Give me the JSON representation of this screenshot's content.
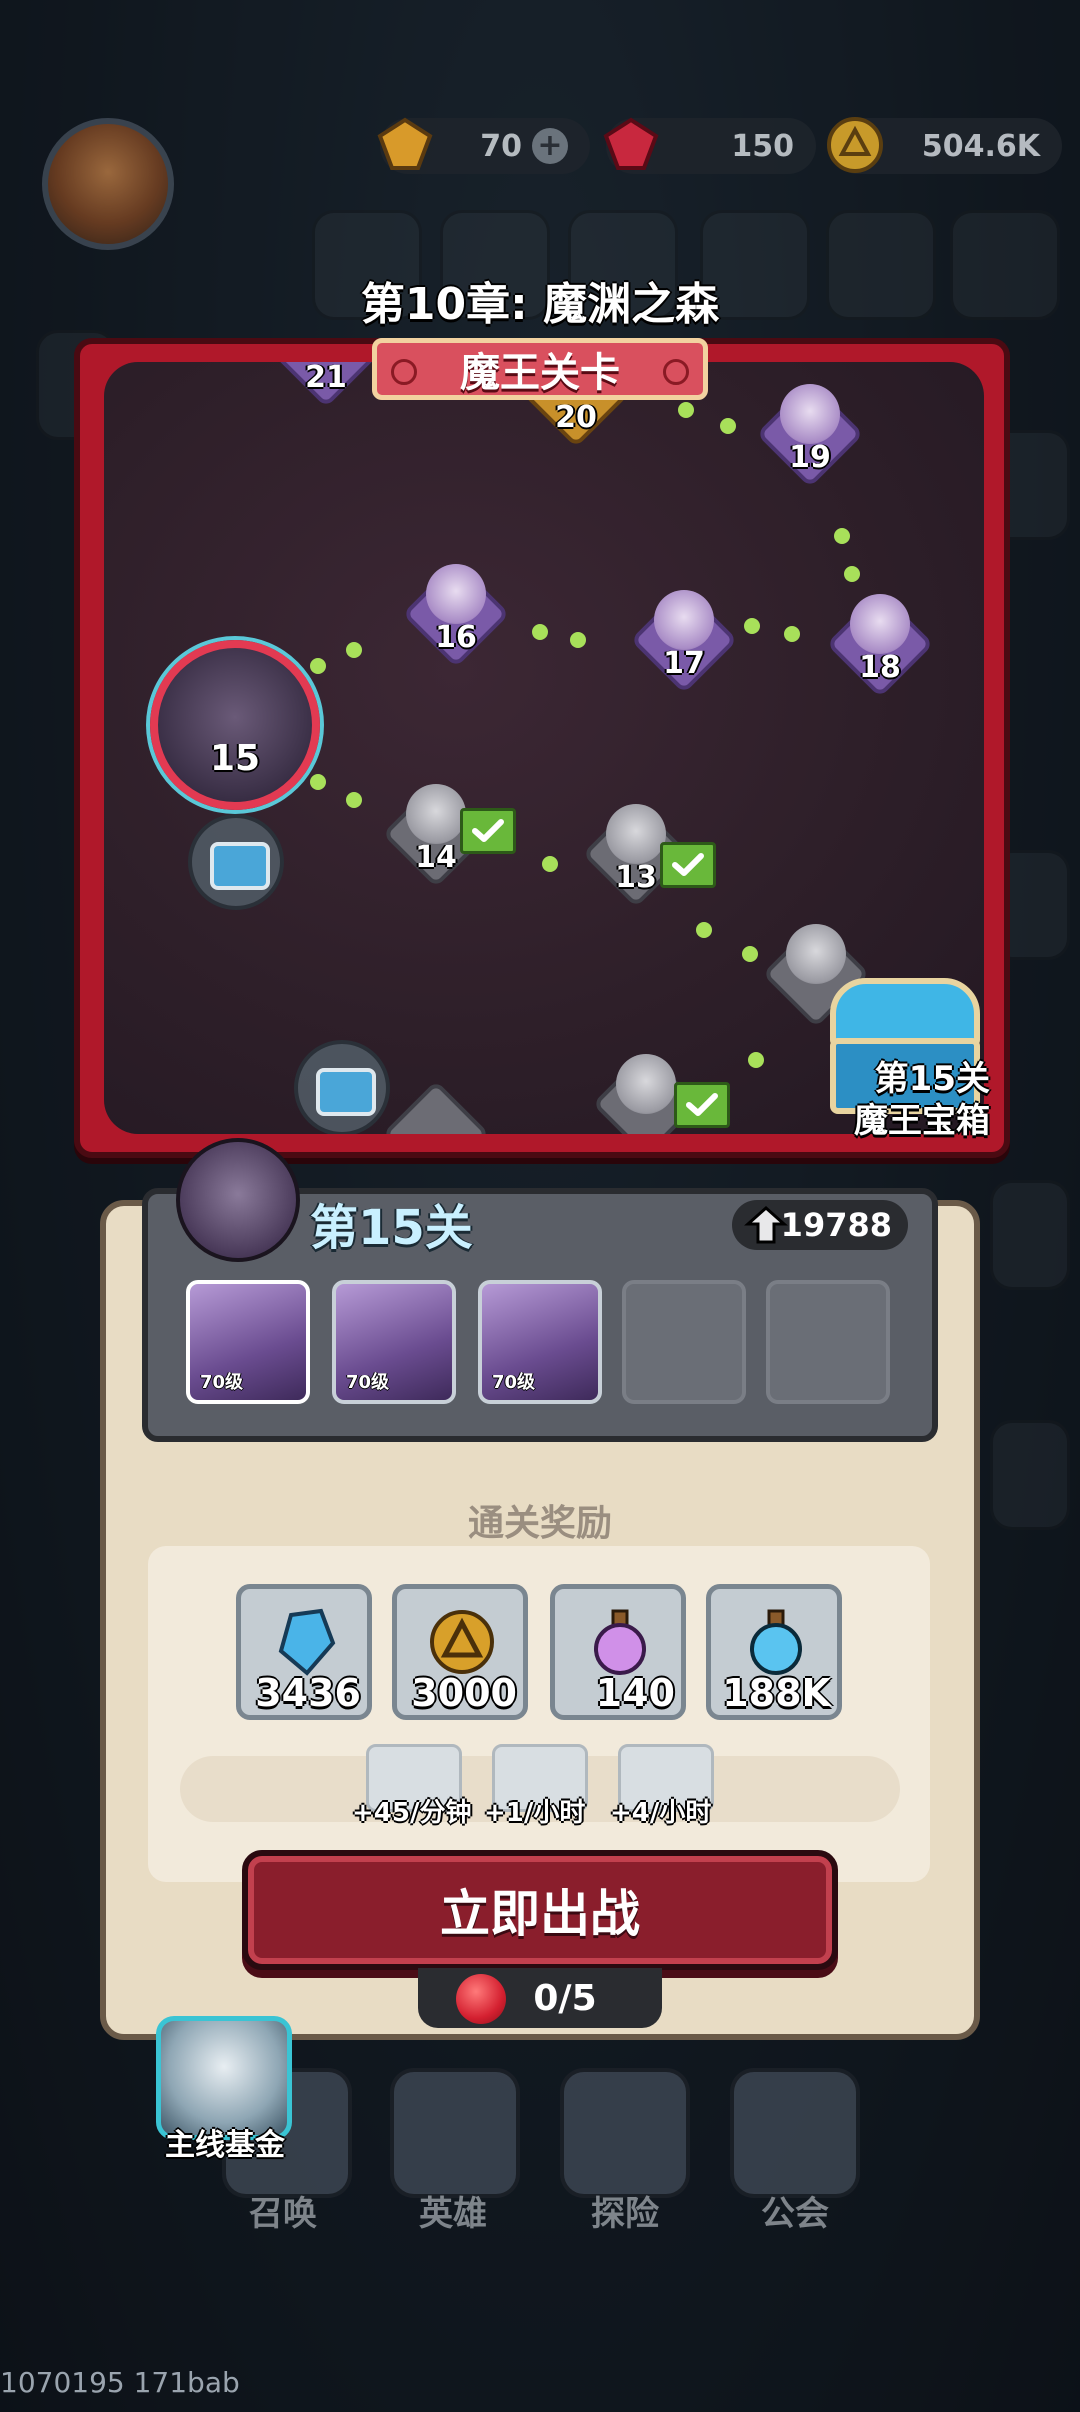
{
  "colors": {
    "map_frame": "#b0182a",
    "panel_bg": "#e8dcc4",
    "battle_button": "#8a1e2c",
    "done_flag": "#69b83a",
    "path_dot": "#a8e05a"
  },
  "resources": [
    {
      "icon": "gem-amber-icon",
      "value": "70"
    },
    {
      "icon": "gem-red-icon",
      "value": "150"
    },
    {
      "icon": "gold-coin-icon",
      "value": "504.6K"
    }
  ],
  "chapter_title": "第10章: 魔渊之森",
  "boss_banner": "魔王关卡",
  "map": {
    "stages": [
      {
        "num": "21",
        "state": "boss"
      },
      {
        "num": "20",
        "state": "boss"
      },
      {
        "num": "19",
        "state": "boss"
      },
      {
        "num": "18",
        "state": "boss"
      },
      {
        "num": "17",
        "state": "boss"
      },
      {
        "num": "16",
        "state": "boss"
      },
      {
        "num": "15",
        "state": "current"
      },
      {
        "num": "14",
        "state": "done"
      },
      {
        "num": "13",
        "state": "done"
      }
    ],
    "chest_label_line1": "第15关",
    "chest_label_line2": "魔王宝箱"
  },
  "stage": {
    "label": "第15关",
    "power": "19788",
    "enemies": [
      {
        "level": "70级"
      },
      {
        "level": "70级"
      },
      {
        "level": "70级"
      }
    ],
    "empty_slots": 2
  },
  "rewards": {
    "title": "通关奖励",
    "items": [
      {
        "icon": "crystal-icon",
        "count": "3436"
      },
      {
        "icon": "gold-coin-icon",
        "count": "3000"
      },
      {
        "icon": "purple-potion-icon",
        "count": "140"
      },
      {
        "icon": "blue-potion-icon",
        "count": "188K"
      }
    ],
    "rates": [
      "+45/分钟",
      "+1/小时",
      "+4/小时"
    ]
  },
  "battle_button": "立即出战",
  "stamina": "0/5",
  "fund_label": "主线基金",
  "nav": [
    "召唤",
    "英雄",
    "探险",
    "公会"
  ],
  "footer_id": "1070195 171bab"
}
